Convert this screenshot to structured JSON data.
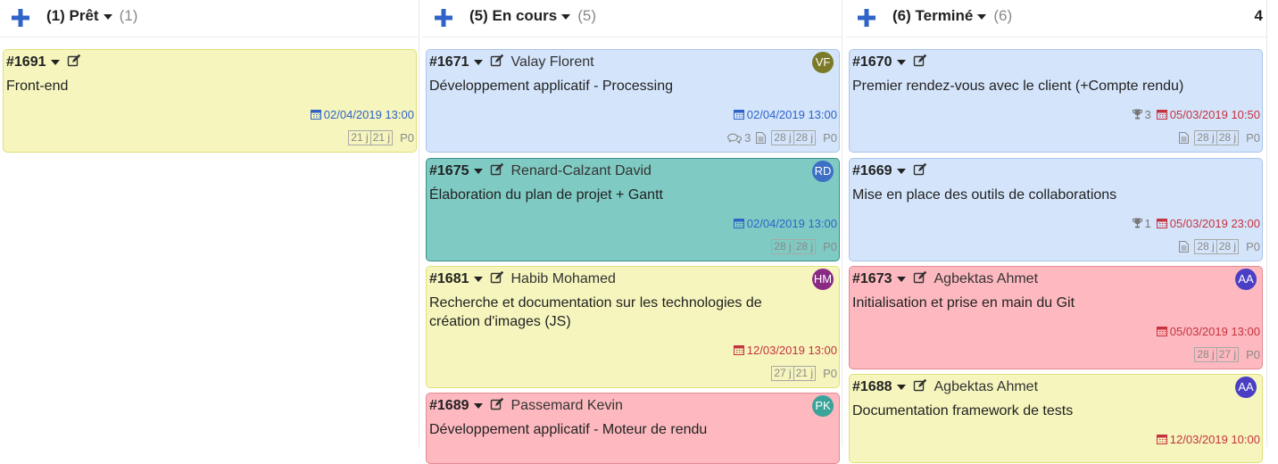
{
  "columns": [
    {
      "title": "(1) Prêt",
      "count": "(1)",
      "right_label": "",
      "cards": [
        {
          "id": "#1691",
          "assignee": "",
          "initials": "",
          "title": "Front-end",
          "date": "02/04/2019 13:00",
          "date_color": "blue",
          "msgs": "",
          "trophy": "",
          "doc": false,
          "est": "21 j",
          "spent": "21 j",
          "prio": "P0",
          "color": "yellow"
        }
      ]
    },
    {
      "title": "(5) En cours",
      "count": "(5)",
      "right_label": "",
      "cards": [
        {
          "id": "#1671",
          "assignee": "Valay Florent",
          "initials": "VF",
          "avatar_color": "#7a7a28",
          "title": "Développement applicatif - Processing",
          "date": "02/04/2019 13:00",
          "date_color": "blue",
          "msgs": "3",
          "trophy": "",
          "doc": true,
          "est": "28 j",
          "spent": "28 j",
          "prio": "P0",
          "color": "blue"
        },
        {
          "id": "#1675",
          "assignee": "Renard-Calzant David",
          "initials": "RD",
          "avatar_color": "#3d6fc4",
          "title": "Élaboration du plan de projet + Gantt",
          "date": "02/04/2019 13:00",
          "date_color": "blue",
          "msgs": "",
          "trophy": "",
          "doc": false,
          "est": "28 j",
          "spent": "28 j",
          "prio": "P0",
          "color": "teal"
        },
        {
          "id": "#1681",
          "assignee": "Habib Mohamed",
          "initials": "HM",
          "avatar_color": "#8a2a84",
          "title": "Recherche et documentation sur les technologies de création d'images (JS)",
          "date": "12/03/2019 13:00",
          "date_color": "red",
          "msgs": "",
          "trophy": "",
          "doc": false,
          "est": "27 j",
          "spent": "21 j",
          "prio": "P0",
          "color": "yellow"
        },
        {
          "id": "#1689",
          "assignee": "Passemard Kevin",
          "initials": "PK",
          "avatar_color": "#3aa39a",
          "title": "Développement applicatif - Moteur de rendu",
          "date": "",
          "date_color": "blue",
          "msgs": "",
          "trophy": "",
          "doc": false,
          "est": "",
          "spent": "",
          "prio": "",
          "color": "red"
        }
      ]
    },
    {
      "title": "(6) Terminé",
      "count": "(6)",
      "right_label": "4",
      "cards": [
        {
          "id": "#1670",
          "assignee": "",
          "initials": "",
          "title": "Premier rendez-vous avec le client (+Compte rendu)",
          "date": "05/03/2019 10:50",
          "date_color": "red",
          "msgs": "",
          "trophy": "3",
          "doc": true,
          "est": "28 j",
          "spent": "28 j",
          "prio": "P0",
          "color": "blue"
        },
        {
          "id": "#1669",
          "assignee": "",
          "initials": "",
          "title": "Mise en place des outils de collaborations",
          "date": "05/03/2019 23:00",
          "date_color": "red",
          "msgs": "",
          "trophy": "1",
          "doc": true,
          "est": "28 j",
          "spent": "28 j",
          "prio": "P0",
          "color": "blue"
        },
        {
          "id": "#1673",
          "assignee": "Agbektas Ahmet",
          "initials": "AA",
          "avatar_color": "#4a3fc4",
          "title": "Initialisation et prise en main du Git",
          "date": "05/03/2019 13:00",
          "date_color": "red",
          "msgs": "",
          "trophy": "",
          "doc": false,
          "est": "28 j",
          "spent": "27 j",
          "prio": "P0",
          "color": "red"
        },
        {
          "id": "#1688",
          "assignee": "Agbektas Ahmet",
          "initials": "AA",
          "avatar_color": "#4a3fc4",
          "title": "Documentation framework de tests",
          "date": "12/03/2019 10:00",
          "date_color": "red",
          "msgs": "",
          "trophy": "",
          "doc": false,
          "est": "",
          "spent": "",
          "prio": "",
          "color": "yellow"
        }
      ]
    }
  ]
}
